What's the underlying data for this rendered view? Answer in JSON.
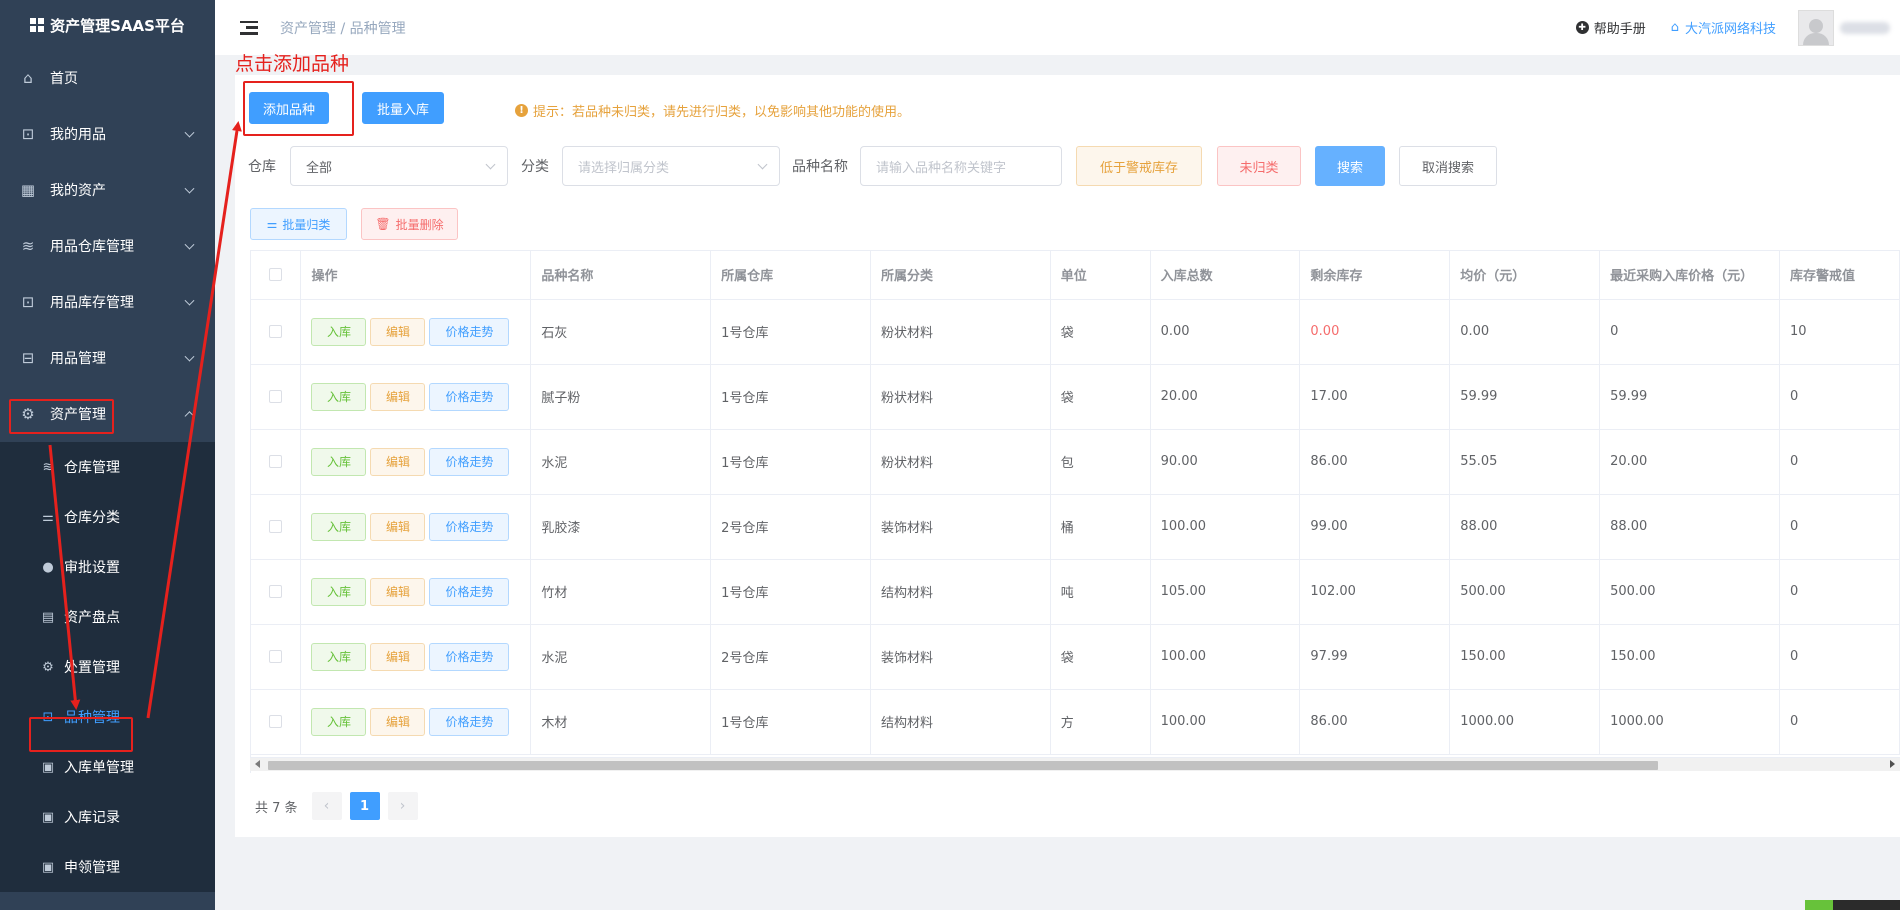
{
  "sidebar": {
    "brand": "资产管理SAAS平台",
    "menu": [
      {
        "label": "首页",
        "icon": "home-icon",
        "has_chevron": false
      },
      {
        "label": "我的用品",
        "icon": "bag-icon",
        "has_chevron": true
      },
      {
        "label": "我的资产",
        "icon": "building-icon",
        "has_chevron": true
      },
      {
        "label": "用品仓库管理",
        "icon": "database-icon",
        "has_chevron": true
      },
      {
        "label": "用品库存管理",
        "icon": "bag-icon",
        "has_chevron": true
      },
      {
        "label": "用品管理",
        "icon": "tray-icon",
        "has_chevron": true
      },
      {
        "label": "资产管理",
        "icon": "gear-icon",
        "has_chevron": true,
        "expanded": true
      }
    ],
    "submenu": [
      {
        "label": "仓库管理",
        "icon": "database-icon"
      },
      {
        "label": "仓库分类",
        "icon": "sliders-icon"
      },
      {
        "label": "审批设置",
        "icon": "user-icon"
      },
      {
        "label": "资产盘点",
        "icon": "document-icon"
      },
      {
        "label": "处置管理",
        "icon": "gear-icon"
      },
      {
        "label": "品种管理",
        "icon": "bag-icon",
        "active": true
      },
      {
        "label": "入库单管理",
        "icon": "clipboard-icon"
      },
      {
        "label": "入库记录",
        "icon": "clipboard-icon"
      },
      {
        "label": "申领管理",
        "icon": "clipboard-icon"
      }
    ]
  },
  "header": {
    "breadcrumb": [
      "资产管理",
      "品种管理"
    ],
    "help": "帮助手册",
    "company": "大汽派网络科技"
  },
  "annotation": {
    "text": "点击添加品种",
    "color": "#e5211d"
  },
  "toolbar": {
    "add_label": "添加品种",
    "batch_in_label": "批量入库",
    "tip": "提示：若品种未归类，请先进行归类，以免影响其他功能的使用。"
  },
  "filters": {
    "warehouse_label": "仓库",
    "warehouse_value": "全部",
    "category_label": "分类",
    "category_placeholder": "请选择归属分类",
    "name_label": "品种名称",
    "name_placeholder": "请输入品种名称关键字",
    "low_stock_label": "低于警戒库存",
    "unclassified_label": "未归类",
    "search_label": "搜索",
    "cancel_label": "取消搜索"
  },
  "batch": {
    "classify_label": "批量归类",
    "delete_label": "批量删除"
  },
  "table": {
    "columns": [
      "操作",
      "品种名称",
      "所属仓库",
      "所属分类",
      "单位",
      "入库总数",
      "剩余库存",
      "均价（元）",
      "最近采购入库价格（元）",
      "库存警戒值"
    ],
    "action_labels": {
      "in": "入库",
      "edit": "编辑",
      "price": "价格走势"
    },
    "rows": [
      {
        "name": "石灰",
        "warehouse": "1号仓库",
        "category": "粉状材料",
        "unit": "袋",
        "total_in": "0.00",
        "remaining": "0.00",
        "remaining_alert": true,
        "avg_price": "0.00",
        "last_price": "0",
        "alert_value": "10"
      },
      {
        "name": "腻子粉",
        "warehouse": "1号仓库",
        "category": "粉状材料",
        "unit": "袋",
        "total_in": "20.00",
        "remaining": "17.00",
        "remaining_alert": false,
        "avg_price": "59.99",
        "last_price": "59.99",
        "alert_value": "0"
      },
      {
        "name": "水泥",
        "warehouse": "1号仓库",
        "category": "粉状材料",
        "unit": "包",
        "total_in": "90.00",
        "remaining": "86.00",
        "remaining_alert": false,
        "avg_price": "55.05",
        "last_price": "20.00",
        "alert_value": "0"
      },
      {
        "name": "乳胶漆",
        "warehouse": "2号仓库",
        "category": "装饰材料",
        "unit": "桶",
        "total_in": "100.00",
        "remaining": "99.00",
        "remaining_alert": false,
        "avg_price": "88.00",
        "last_price": "88.00",
        "alert_value": "0"
      },
      {
        "name": "竹材",
        "warehouse": "1号仓库",
        "category": "结构材料",
        "unit": "吨",
        "total_in": "105.00",
        "remaining": "102.00",
        "remaining_alert": false,
        "avg_price": "500.00",
        "last_price": "500.00",
        "alert_value": "0"
      },
      {
        "name": "水泥",
        "warehouse": "2号仓库",
        "category": "装饰材料",
        "unit": "袋",
        "total_in": "100.00",
        "remaining": "97.99",
        "remaining_alert": false,
        "avg_price": "150.00",
        "last_price": "150.00",
        "alert_value": "0"
      },
      {
        "name": "木材",
        "warehouse": "1号仓库",
        "category": "结构材料",
        "unit": "方",
        "total_in": "100.00",
        "remaining": "86.00",
        "remaining_alert": false,
        "avg_price": "1000.00",
        "last_price": "1000.00",
        "alert_value": "0"
      }
    ]
  },
  "pagination": {
    "total_text": "共 7 条",
    "current_page": "1",
    "prev": "‹",
    "next": "›"
  },
  "colors": {
    "sidebar_bg": "#304156",
    "primary": "#409eff",
    "annotation_red": "#e5211d",
    "warning": "#e6a23c",
    "danger": "#f56c6c",
    "success": "#67c23a"
  }
}
